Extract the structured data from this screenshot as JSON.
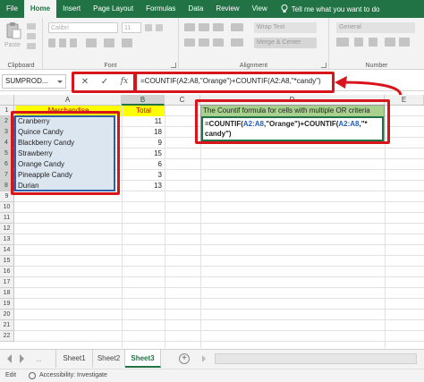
{
  "ribbon_tabs": [
    "File",
    "Home",
    "Insert",
    "Page Layout",
    "Formulas",
    "Data",
    "Review",
    "View"
  ],
  "tell_me": "Tell me what you want to do",
  "ribbon": {
    "paste_label": "Paste",
    "clipboard_label": "Clipboard",
    "font_label": "Font",
    "font_name": "Calibri",
    "font_size": "11",
    "alignment_label": "Alignment",
    "wrap_text": "Wrap Text",
    "merge_center": "Merge & Center",
    "number_label": "Number",
    "number_format": "General"
  },
  "formula_bar": {
    "name_box": "SUMPROD...",
    "cancel": "✕",
    "enter": "✓",
    "fx": "fx",
    "formula": "=COUNTIF(A2:A8,\"Orange\")+COUNTIF(A2:A8,\"*candy\")"
  },
  "grid": {
    "columns": [
      "A",
      "B",
      "C",
      "D",
      "E"
    ],
    "rows": [
      "1",
      "2",
      "3",
      "4",
      "5",
      "6",
      "7",
      "8",
      "9",
      "10",
      "11",
      "12",
      "13",
      "14",
      "15",
      "16",
      "17",
      "18",
      "19",
      "20",
      "21",
      "22"
    ],
    "header_a": "Merchandise",
    "header_b": "Total",
    "items": [
      {
        "name": "Cranberry",
        "total": "11"
      },
      {
        "name": "Quince Candy",
        "total": "18"
      },
      {
        "name": "Blackberry Candy",
        "total": "9"
      },
      {
        "name": "Strawberry",
        "total": "15"
      },
      {
        "name": "Orange Candy",
        "total": "6"
      },
      {
        "name": "Pineapple Candy",
        "total": "3"
      },
      {
        "name": "Durian",
        "total": "13"
      }
    ]
  },
  "note": {
    "title": "The Countif formula for cells with multiple OR criteria",
    "formula_part1": "=COUNTIF(",
    "range1": "A2:A8",
    "formula_part2": ",\"Orange\")+COUNTIF(",
    "range2": "A2:A8",
    "formula_part3": ",\"*",
    "formula_line2": "candy\")"
  },
  "sheets": [
    "Sheet1",
    "Sheet2",
    "Sheet3"
  ],
  "active_sheet": "Sheet3",
  "status": {
    "mode": "Edit",
    "accessibility": "Accessibility: Investigate"
  },
  "colors": {
    "excel_green": "#217346",
    "highlight_red": "#d9151c",
    "header_yellow": "#ffff00",
    "list_blue": "#dce6f1",
    "note_green": "#a9d18e"
  }
}
